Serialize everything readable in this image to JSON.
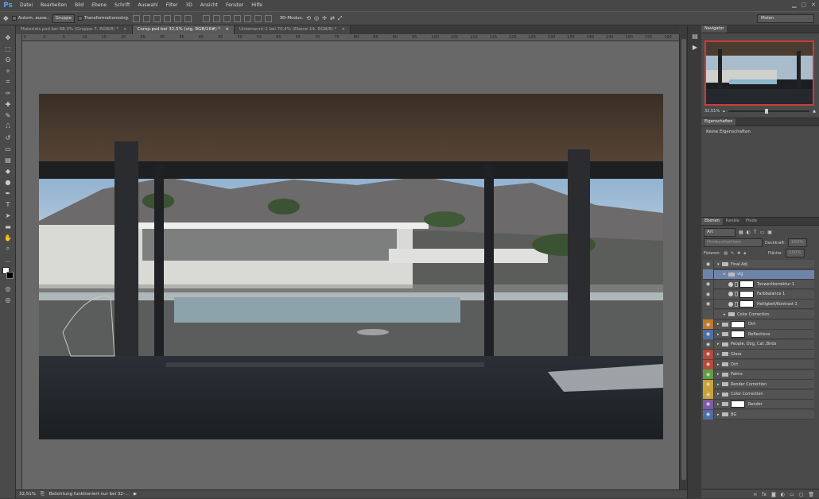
{
  "app": {
    "logo": "Ps"
  },
  "menu": [
    "Datei",
    "Bearbeiten",
    "Bild",
    "Ebene",
    "Schrift",
    "Auswahl",
    "Filter",
    "3D",
    "Ansicht",
    "Fenster",
    "Hilfe"
  ],
  "options": {
    "auto_select_label": "Autom. ausw.:",
    "auto_select_value": "Gruppe",
    "transform_label": "Transformationsstrg.",
    "mode3d_label": "3D-Modus:",
    "workspace": "Malen"
  },
  "tabs": [
    {
      "label": "Materials.psd bei 68,3% (Gruppe 7, RGB/8) *",
      "active": false
    },
    {
      "label": "Comp.psd bei 32,5% (vig, RGB/16#) *",
      "active": true
    },
    {
      "label": "Unbenannt-1 bei 70,4% (Ebene 14, RGB/8) *",
      "active": false
    }
  ],
  "ruler_numbers": [
    "5",
    "0",
    "5",
    "10",
    "15",
    "20",
    "25",
    "30",
    "35",
    "40",
    "45",
    "50",
    "55",
    "60",
    "65",
    "70",
    "75",
    "80",
    "85",
    "90",
    "95",
    "100",
    "105",
    "110",
    "115",
    "120",
    "125",
    "130",
    "135",
    "140",
    "145",
    "150",
    "155",
    "160"
  ],
  "status": {
    "zoom": "32,51%",
    "message": "Belichtung funktioniert nur bei 32-..."
  },
  "navigator": {
    "tab": "Navigator",
    "zoom": "32,51%"
  },
  "properties": {
    "tab": "Eigenschaften",
    "text": "Keine Eigenschaften"
  },
  "layers_panel": {
    "tabs": [
      "Ebenen",
      "Kanäle",
      "Pfade"
    ],
    "filter_kind": "Art",
    "blend_mode": "Hindurchwirken",
    "opacity_label": "Deckkraft:",
    "opacity_value": "100%",
    "lock_label": "Fixieren:",
    "fill_label": "Fläche:",
    "fill_value": "100%",
    "layers": [
      {
        "name": "Final Adj",
        "color": "#535353",
        "type": "group",
        "open": true,
        "indent": 0,
        "eye": true
      },
      {
        "name": "vig",
        "color": "#6e84a8",
        "type": "group",
        "open": false,
        "indent": 1,
        "eye": false
      },
      {
        "name": "Tonwertkorrektur 1",
        "color": "#535353",
        "type": "adjust",
        "indent": 1,
        "eye": true
      },
      {
        "name": "Farbbalance 1",
        "color": "#535353",
        "type": "adjust",
        "indent": 1,
        "eye": true
      },
      {
        "name": "Helligkeit/Kontrast 1",
        "color": "#535353",
        "type": "adjust",
        "indent": 1,
        "eye": true
      },
      {
        "name": "Color Correction",
        "color": "#535353",
        "type": "group",
        "open": false,
        "indent": 1,
        "eye": false
      },
      {
        "name": "Dirt",
        "color": "#c07a2e",
        "type": "group-mask",
        "indent": 0,
        "eye": true
      },
      {
        "name": "Reflections",
        "color": "#4f6ea8",
        "type": "group-mask",
        "indent": 0,
        "eye": true
      },
      {
        "name": "People, Dog, Cat ,Birds",
        "color": "#535353",
        "type": "group",
        "indent": 0,
        "eye": true
      },
      {
        "name": "Glass",
        "color": "#b84a3a",
        "type": "group",
        "indent": 0,
        "eye": true
      },
      {
        "name": "Dirt",
        "color": "#b84a3a",
        "type": "group",
        "indent": 0,
        "eye": true
      },
      {
        "name": "Palms",
        "color": "#5f9e46",
        "type": "group",
        "indent": 0,
        "eye": true
      },
      {
        "name": "Render Correction",
        "color": "#c9a23a",
        "type": "group",
        "indent": 0,
        "eye": true
      },
      {
        "name": "Color Correction",
        "color": "#c9a23a",
        "type": "group",
        "indent": 0,
        "eye": true
      },
      {
        "name": "Render",
        "color": "#7e5aa8",
        "type": "group-mask",
        "indent": 0,
        "eye": true
      },
      {
        "name": "BG",
        "color": "#4f6ea8",
        "type": "group",
        "indent": 0,
        "eye": true
      }
    ]
  }
}
